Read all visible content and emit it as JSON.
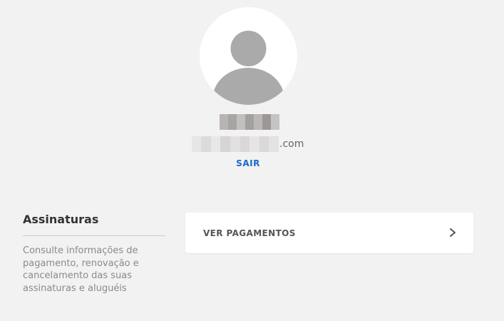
{
  "profile": {
    "email_domain": ".com",
    "logout_label": "SAIR",
    "avatar_icon": "user-silhouette-icon"
  },
  "subscriptions": {
    "title": "Assinaturas",
    "description": "Consulte informações de pagamento, renovação e cancelamento das suas assinaturas e aluguéis",
    "payments_label": "VER PAGAMENTOS",
    "chevron_icon": "chevron-right-icon"
  },
  "colors": {
    "background": "#f2f2f2",
    "card": "#ffffff",
    "link": "#1b6ac9",
    "avatar_silhouette": "#aaaaaa"
  }
}
